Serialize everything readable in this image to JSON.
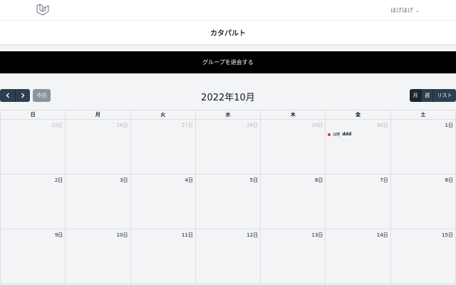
{
  "nav": {
    "logo_icon": "laravel-logo",
    "user_name": "ほげほげ",
    "user_chevron": "chevron-down-icon"
  },
  "page": {
    "title": "カタパルト"
  },
  "actions": {
    "leave_group": "グループを退会する"
  },
  "calendar": {
    "prev_icon": "chevron-left-icon",
    "next_icon": "chevron-right-icon",
    "today_label": "今日",
    "title": "2022年10月",
    "views": {
      "month": "月",
      "week": "週",
      "list": "リスト"
    },
    "active_view": "month",
    "weekdays": [
      "日",
      "月",
      "火",
      "水",
      "木",
      "金",
      "土"
    ],
    "weeks": [
      [
        {
          "label": "25日",
          "other": true
        },
        {
          "label": "26日",
          "other": true
        },
        {
          "label": "27日",
          "other": true
        },
        {
          "label": "28日",
          "other": true
        },
        {
          "label": "29日",
          "other": true
        },
        {
          "label": "30日",
          "other": true
        },
        {
          "label": "1日",
          "other": false
        }
      ],
      [
        {
          "label": "2日",
          "other": false
        },
        {
          "label": "3日",
          "other": false
        },
        {
          "label": "4日",
          "other": false
        },
        {
          "label": "5日",
          "other": false
        },
        {
          "label": "6日",
          "other": false
        },
        {
          "label": "7日",
          "other": false
        },
        {
          "label": "8日",
          "other": false
        }
      ],
      [
        {
          "label": "9日",
          "other": false
        },
        {
          "label": "10日",
          "other": false
        },
        {
          "label": "11日",
          "other": false
        },
        {
          "label": "12日",
          "other": false
        },
        {
          "label": "13日",
          "other": false
        },
        {
          "label": "14日",
          "other": false
        },
        {
          "label": "15日",
          "other": false
        }
      ]
    ],
    "events": [
      {
        "week": 0,
        "day": 5,
        "time": "0時",
        "title": "ddd",
        "color": "#e3342f"
      }
    ]
  }
}
